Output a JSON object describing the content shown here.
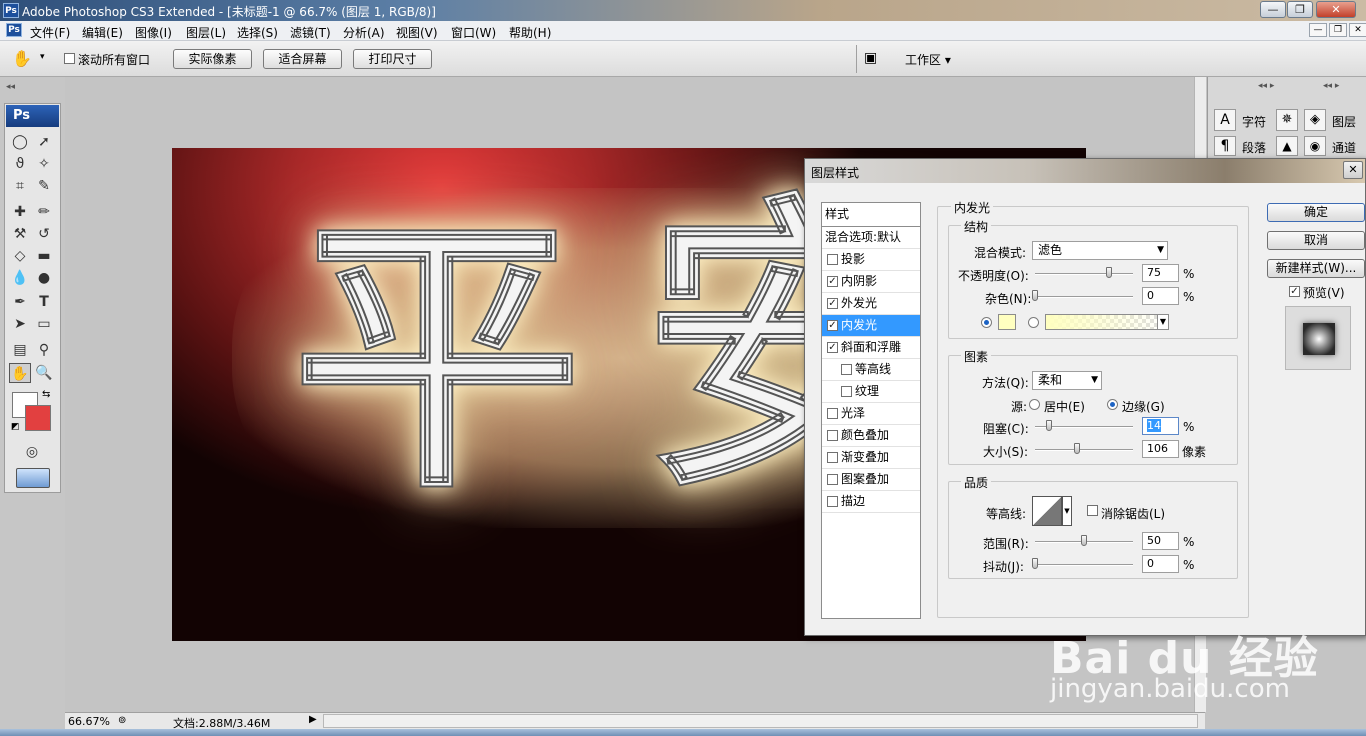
{
  "titlebar": {
    "title": "Adobe Photoshop CS3 Extended - [未标题-1 @ 66.7% (图层 1, RGB/8)]",
    "app_icon": "Ps",
    "min": "—",
    "max": "❐",
    "close": "✕"
  },
  "menubar": {
    "items": [
      "文件(F)",
      "编辑(E)",
      "图像(I)",
      "图层(L)",
      "选择(S)",
      "滤镜(T)",
      "分析(A)",
      "视图(V)",
      "窗口(W)",
      "帮助(H)"
    ],
    "mdi_min": "—",
    "mdi_max": "❐",
    "mdi_close": "✕"
  },
  "options": {
    "scroll_all": "滚动所有窗口",
    "actual_pixels": "实际像素",
    "fit_screen": "适合屏幕",
    "print_size": "打印尺寸",
    "workspace": "工作区 ▾"
  },
  "toolbox": {
    "logo": "Ps"
  },
  "canvas": {
    "char1": "平",
    "char2": "安"
  },
  "right_panel": {
    "char": "字符",
    "para": "段落",
    "layers": "图层",
    "channels": "通道"
  },
  "status": {
    "zoom": "66.67%",
    "doc": "文档:2.88M/3.46M"
  },
  "dialog": {
    "title": "图层样式",
    "styles_header": "样式",
    "blend_options": "混合选项:默认",
    "styles": [
      {
        "label": "投影",
        "checked": false
      },
      {
        "label": "内阴影",
        "checked": true
      },
      {
        "label": "外发光",
        "checked": true
      },
      {
        "label": "内发光",
        "checked": true,
        "selected": true
      },
      {
        "label": "斜面和浮雕",
        "checked": true
      },
      {
        "label": "等高线",
        "checked": false,
        "sub": true
      },
      {
        "label": "纹理",
        "checked": false,
        "sub": true
      },
      {
        "label": "光泽",
        "checked": false
      },
      {
        "label": "颜色叠加",
        "checked": false
      },
      {
        "label": "渐变叠加",
        "checked": false
      },
      {
        "label": "图案叠加",
        "checked": false
      },
      {
        "label": "描边",
        "checked": false
      }
    ],
    "section": "内发光",
    "structure": {
      "title": "结构",
      "blend_mode_label": "混合模式:",
      "blend_mode": "滤色",
      "opacity_label": "不透明度(O):",
      "opacity": "75",
      "noise_label": "杂色(N):",
      "noise": "0",
      "opacity_value": 75,
      "noise_value": 0,
      "glow_color": "#ffffc0"
    },
    "elements": {
      "title": "图素",
      "method_label": "方法(Q):",
      "method": "柔和",
      "source_label": "源:",
      "center": "居中(E)",
      "edge": "边缘(G)",
      "choke_label": "阻塞(C):",
      "choke": "14",
      "size_label": "大小(S):",
      "size": "106",
      "size_unit": "像素",
      "choke_value": 14,
      "size_value": 106
    },
    "quality": {
      "title": "品质",
      "contour_label": "等高线:",
      "antialias": "消除锯齿(L)",
      "range_label": "范围(R):",
      "range": "50",
      "jitter_label": "抖动(J):",
      "jitter": "0",
      "range_value": 50,
      "jitter_value": 0
    },
    "percent": "%",
    "ok": "确定",
    "cancel": "取消",
    "new_style": "新建样式(W)...",
    "preview": "预览(V)"
  },
  "watermark": {
    "brand": "Bai du 经验",
    "url": "jingyan.baidu.com"
  }
}
